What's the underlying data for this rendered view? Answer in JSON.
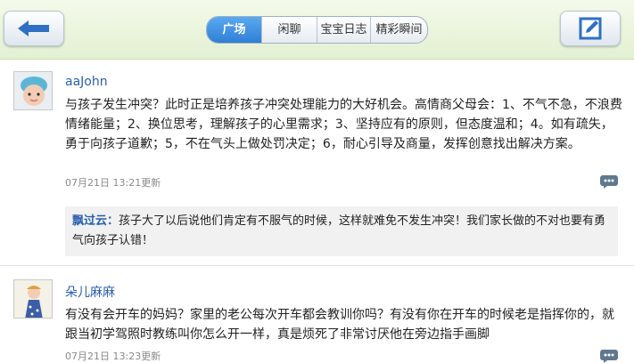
{
  "header": {
    "tabs": [
      {
        "label": "广场",
        "active": true
      },
      {
        "label": "闲聊",
        "active": false
      },
      {
        "label": "宝宝日志",
        "active": false
      },
      {
        "label": "精彩瞬间",
        "active": false
      }
    ],
    "back_icon": "back-arrow-icon",
    "edit_icon": "compose-icon"
  },
  "posts": [
    {
      "author": "aaJohn",
      "content": "与孩子发生冲突？此时正是培养孩子冲突处理能力的大好机会。高情商父母会：1、不气不急，不浪费情绪能量；2、换位思考，理解孩子的心里需求；3、坚持应有的原则，但态度温和；4。如有疏失，勇于向孩子道歉；5，不在气头上做处罚决定；6，耐心引导及商量，发挥创意找出解决方案。",
      "time": "07月21日 13:21更新",
      "reply": {
        "who": "飘过云：",
        "text": "孩子大了以后说他们肯定有不服气的时候，这样就难免不发生冲突！我们家长做的不对也要有勇气向孩子认错！"
      }
    },
    {
      "author": "朵儿麻麻",
      "content": "有没有会开车的妈妈？家里的老公每次开车都会教训你吗？有没有你在开车的时候老是指挥你的，就跟当初学驾照时教练叫你怎么开一样，真是烦死了非常讨厌他在旁边指手画脚",
      "time": "07月21日 13:23更新"
    }
  ],
  "colors": {
    "author": "#2a5fae",
    "tab_active": "#3b8be0"
  }
}
